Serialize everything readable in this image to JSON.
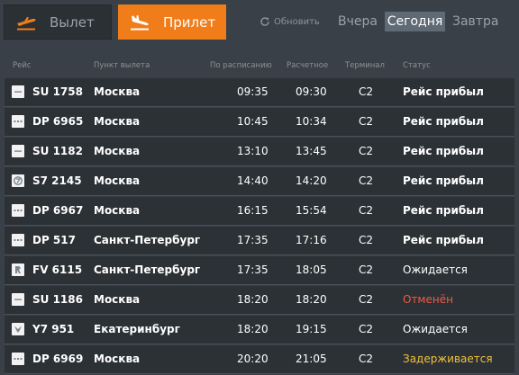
{
  "tabs": {
    "departure_label": "Вылет",
    "arrival_label": "Прилет"
  },
  "refresh_label": "Обновить",
  "days": {
    "yesterday": "Вчера",
    "today": "Сегодня",
    "tomorrow": "Завтра"
  },
  "columns": {
    "flight": "Рейс",
    "origin": "Пункт вылета",
    "scheduled": "По расписанию",
    "estimated": "Расчетное",
    "terminal": "Терминал",
    "status": "Статус"
  },
  "colors": {
    "accent": "#f07d1a",
    "cancelled": "#f05a45",
    "delayed": "#f0c13a"
  },
  "flights": [
    {
      "logo": "aeroflot-logo-icon",
      "flight": "SU 1758",
      "origin": "Москва",
      "scheduled": "09:35",
      "estimated": "09:30",
      "terminal": "C2",
      "status": "Рейс прибыл",
      "status_kind": "arrived"
    },
    {
      "logo": "pobeda-logo-icon",
      "flight": "DP 6965",
      "origin": "Москва",
      "scheduled": "10:45",
      "estimated": "10:34",
      "terminal": "C2",
      "status": "Рейс прибыл",
      "status_kind": "arrived"
    },
    {
      "logo": "aeroflot-logo-icon",
      "flight": "SU 1182",
      "origin": "Москва",
      "scheduled": "13:10",
      "estimated": "13:45",
      "terminal": "C2",
      "status": "Рейс прибыл",
      "status_kind": "arrived"
    },
    {
      "logo": "s7-logo-icon",
      "flight": "S7 2145",
      "origin": "Москва",
      "scheduled": "14:40",
      "estimated": "14:20",
      "terminal": "C2",
      "status": "Рейс прибыл",
      "status_kind": "arrived"
    },
    {
      "logo": "pobeda-logo-icon",
      "flight": "DP 6967",
      "origin": "Москва",
      "scheduled": "16:15",
      "estimated": "15:54",
      "terminal": "C2",
      "status": "Рейс прибыл",
      "status_kind": "arrived"
    },
    {
      "logo": "pobeda-logo-icon",
      "flight": "DP 517",
      "origin": "Санкт-Петербург",
      "scheduled": "17:35",
      "estimated": "17:16",
      "terminal": "C2",
      "status": "Рейс прибыл",
      "status_kind": "arrived"
    },
    {
      "logo": "rossiya-logo-icon",
      "flight": "FV 6115",
      "origin": "Санкт-Петербург",
      "scheduled": "17:35",
      "estimated": "18:05",
      "terminal": "C2",
      "status": "Ожидается",
      "status_kind": "expected"
    },
    {
      "logo": "aeroflot-logo-icon",
      "flight": "SU 1186",
      "origin": "Москва",
      "scheduled": "18:20",
      "estimated": "18:20",
      "terminal": "C2",
      "status": "Отменён",
      "status_kind": "cancelled"
    },
    {
      "logo": "ural-logo-icon",
      "flight": "Y7 951",
      "origin": "Екатеринбург",
      "scheduled": "18:20",
      "estimated": "19:15",
      "terminal": "C2",
      "status": "Ожидается",
      "status_kind": "expected"
    },
    {
      "logo": "pobeda-logo-icon",
      "flight": "DP 6969",
      "origin": "Москва",
      "scheduled": "20:20",
      "estimated": "21:05",
      "terminal": "C2",
      "status": "Задерживается",
      "status_kind": "delayed"
    }
  ]
}
